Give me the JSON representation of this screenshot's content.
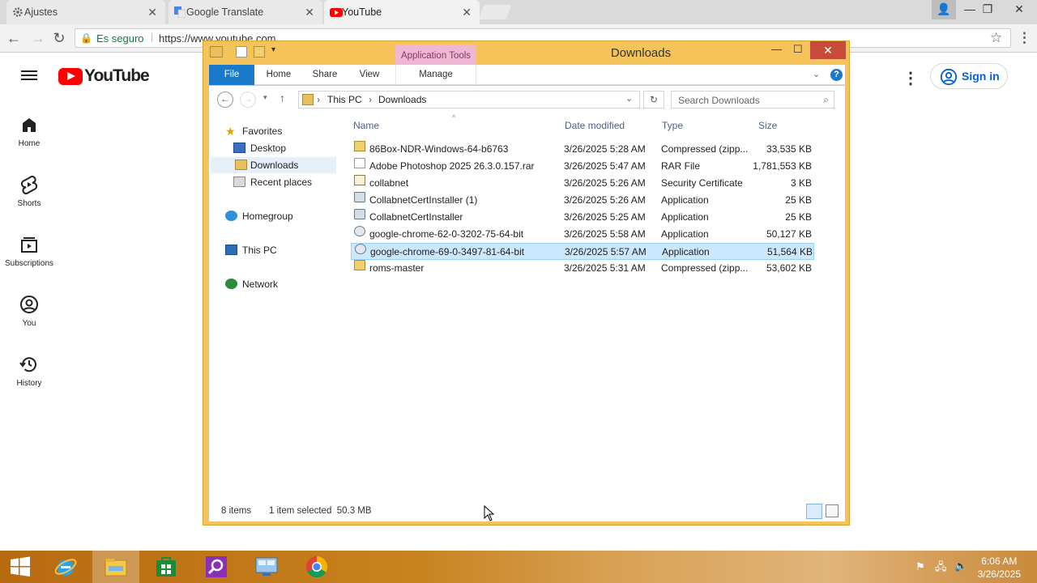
{
  "browser": {
    "tabs": [
      {
        "title": "Ajustes",
        "active": false
      },
      {
        "title": "Google Translate",
        "active": false
      },
      {
        "title": "YouTube",
        "active": true
      }
    ],
    "secure_label": "Es seguro",
    "url": "https://www.youtube.com"
  },
  "youtube": {
    "logo_text": "YouTube",
    "nav": [
      {
        "label": "Home",
        "icon": "home-icon"
      },
      {
        "label": "Shorts",
        "icon": "shorts-icon"
      },
      {
        "label": "Subscriptions",
        "icon": "subscriptions-icon"
      },
      {
        "label": "You",
        "icon": "you-icon"
      },
      {
        "label": "History",
        "icon": "history-icon"
      }
    ],
    "sign_in": "Sign in"
  },
  "explorer": {
    "title": "Downloads",
    "app_tools": "Application Tools",
    "ribbon_tabs": [
      "File",
      "Home",
      "Share",
      "View",
      "Manage"
    ],
    "breadcrumb": [
      "This PC",
      "Downloads"
    ],
    "search_placeholder": "Search Downloads",
    "nav": {
      "favorites": "Favorites",
      "desktop": "Desktop",
      "downloads": "Downloads",
      "recent": "Recent places",
      "homegroup": "Homegroup",
      "this_pc": "This PC",
      "network": "Network"
    },
    "columns": {
      "name": "Name",
      "date": "Date modified",
      "type": "Type",
      "size": "Size"
    },
    "files": [
      {
        "name": "86Box-NDR-Windows-64-b6763",
        "date": "3/26/2025 5:28 AM",
        "type": "Compressed (zipp...",
        "size": "33,535 KB",
        "icon": "zip-folder-icon"
      },
      {
        "name": "Adobe Photoshop 2025 26.3.0.157.rar",
        "date": "3/26/2025 5:47 AM",
        "type": "RAR File",
        "size": "1,781,553 KB",
        "icon": "file-icon"
      },
      {
        "name": "collabnet",
        "date": "3/26/2025 5:26 AM",
        "type": "Security Certificate",
        "size": "3 KB",
        "icon": "certificate-icon"
      },
      {
        "name": "CollabnetCertInstaller (1)",
        "date": "3/26/2025 5:26 AM",
        "type": "Application",
        "size": "25 KB",
        "icon": "application-icon"
      },
      {
        "name": "CollabnetCertInstaller",
        "date": "3/26/2025 5:25 AM",
        "type": "Application",
        "size": "25 KB",
        "icon": "application-icon"
      },
      {
        "name": "google-chrome-62-0-3202-75-64-bit",
        "date": "3/26/2025 5:58 AM",
        "type": "Application",
        "size": "50,127 KB",
        "icon": "installer-icon"
      },
      {
        "name": "google-chrome-69-0-3497-81-64-bit",
        "date": "3/26/2025 5:57 AM",
        "type": "Application",
        "size": "51,564 KB",
        "icon": "installer-icon",
        "selected": true
      },
      {
        "name": "roms-master",
        "date": "3/26/2025 5:31 AM",
        "type": "Compressed (zipp...",
        "size": "53,602 KB",
        "icon": "zip-folder-icon"
      }
    ],
    "status": {
      "count": "8 items",
      "selection": "1 item selected  50.3 MB"
    }
  },
  "taskbar": {
    "time": "6:06 AM",
    "date": "3/26/2025"
  }
}
